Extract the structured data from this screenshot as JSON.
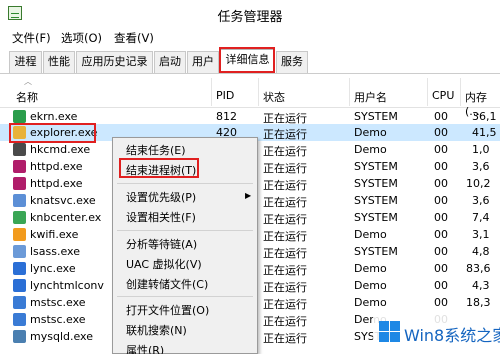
{
  "window": {
    "title": "任务管理器"
  },
  "menu": [
    "文件(F)",
    "选项(O)",
    "查看(V)"
  ],
  "tabs": [
    "进程",
    "性能",
    "应用历史记录",
    "启动",
    "用户",
    "详细信息",
    "服务"
  ],
  "active_tab": "详细信息",
  "columns": {
    "name": "名称",
    "pid": "PID",
    "status": "状态",
    "user": "用户名",
    "cpu": "CPU",
    "memory": "内存(..."
  },
  "rows": [
    {
      "name": "ekrn.exe",
      "pid": "812",
      "status": "正在运行",
      "user": "SYSTEM",
      "cpu": "00",
      "mem": "36,1",
      "icon_color": "#2a9d4b"
    },
    {
      "name": "explorer.exe",
      "pid": "420",
      "status": "正在运行",
      "user": "Demo",
      "cpu": "00",
      "mem": "41,5",
      "icon_color": "#e8b23a"
    },
    {
      "name": "hkcmd.exe",
      "pid": "",
      "status": "正在运行",
      "user": "Demo",
      "cpu": "00",
      "mem": "1,0",
      "icon_color": "#4a4a4a"
    },
    {
      "name": "httpd.exe",
      "pid": "",
      "status": "正在运行",
      "user": "SYSTEM",
      "cpu": "00",
      "mem": "3,6",
      "icon_color": "#b01d6a"
    },
    {
      "name": "httpd.exe",
      "pid": "",
      "status": "正在运行",
      "user": "SYSTEM",
      "cpu": "00",
      "mem": "10,2",
      "icon_color": "#b01d6a"
    },
    {
      "name": "knatsvc.exe",
      "pid": "",
      "status": "正在运行",
      "user": "SYSTEM",
      "cpu": "00",
      "mem": "3,6",
      "icon_color": "#5c8fd6"
    },
    {
      "name": "knbcenter.ex",
      "pid": "",
      "status": "正在运行",
      "user": "SYSTEM",
      "cpu": "00",
      "mem": "7,4",
      "icon_color": "#3aa655"
    },
    {
      "name": "kwifi.exe",
      "pid": "",
      "status": "正在运行",
      "user": "Demo",
      "cpu": "00",
      "mem": "3,1",
      "icon_color": "#f29b1d"
    },
    {
      "name": "lsass.exe",
      "pid": "",
      "status": "正在运行",
      "user": "SYSTEM",
      "cpu": "00",
      "mem": "4,8",
      "icon_color": "#6b9ad8"
    },
    {
      "name": "lync.exe",
      "pid": "",
      "status": "正在运行",
      "user": "Demo",
      "cpu": "00",
      "mem": "83,6",
      "icon_color": "#2b6fd6"
    },
    {
      "name": "lynchtmlconv",
      "pid": "",
      "status": "正在运行",
      "user": "Demo",
      "cpu": "00",
      "mem": "4,3",
      "icon_color": "#2b6fd6"
    },
    {
      "name": "mstsc.exe",
      "pid": "",
      "status": "正在运行",
      "user": "Demo",
      "cpu": "00",
      "mem": "18,3",
      "icon_color": "#3a7bd5"
    },
    {
      "name": "mstsc.exe",
      "pid": "",
      "status": "正在运行",
      "user": "Demo",
      "cpu": "00",
      "mem": "",
      "icon_color": "#3a7bd5"
    },
    {
      "name": "mysqld.exe",
      "pid": "",
      "status": "正在运行",
      "user": "SYSTEM",
      "cpu": "",
      "mem": "",
      "icon_color": "#4a7fb0"
    }
  ],
  "context_menu": {
    "items": [
      "结束任务(E)",
      "结束进程树(T)",
      "设置优先级(P)",
      "设置相关性(F)",
      "分析等待链(A)",
      "UAC 虚拟化(V)",
      "创建转储文件(C)",
      "打开文件位置(O)",
      "联机搜索(N)",
      "属性(R)"
    ]
  },
  "watermark": {
    "text": "Win8系统之家"
  },
  "colors": {
    "selection": "#cce8ff",
    "highlight": "#e02020"
  }
}
